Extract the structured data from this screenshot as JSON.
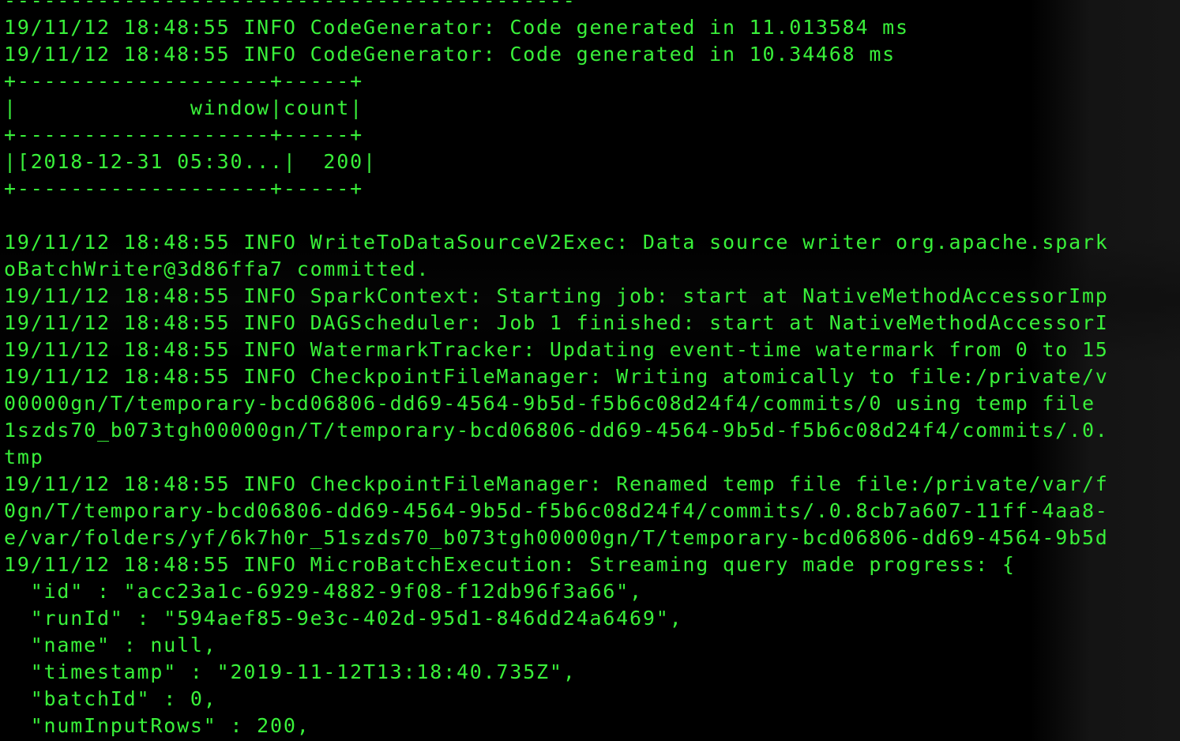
{
  "colors": {
    "background": "#000000",
    "text": "#39f03a"
  },
  "terminal": {
    "lines": [
      "-------------------------------------------",
      "19/11/12 18:48:55 INFO CodeGenerator: Code generated in 11.013584 ms",
      "19/11/12 18:48:55 INFO CodeGenerator: Code generated in 10.34468 ms",
      "+-------------------+-----+",
      "|             window|count|",
      "+-------------------+-----+",
      "|[2018-12-31 05:30...|  200|",
      "+-------------------+-----+",
      "",
      "19/11/12 18:48:55 INFO WriteToDataSourceV2Exec: Data source writer org.apache.spark",
      "oBatchWriter@3d86ffa7 committed.",
      "19/11/12 18:48:55 INFO SparkContext: Starting job: start at NativeMethodAccessorImp",
      "19/11/12 18:48:55 INFO DAGScheduler: Job 1 finished: start at NativeMethodAccessorI",
      "19/11/12 18:48:55 INFO WatermarkTracker: Updating event-time watermark from 0 to 15",
      "19/11/12 18:48:55 INFO CheckpointFileManager: Writing atomically to file:/private/v",
      "00000gn/T/temporary-bcd06806-dd69-4564-9b5d-f5b6c08d24f4/commits/0 using temp file",
      "1szds70_b073tgh00000gn/T/temporary-bcd06806-dd69-4564-9b5d-f5b6c08d24f4/commits/.0.",
      "tmp",
      "19/11/12 18:48:55 INFO CheckpointFileManager: Renamed temp file file:/private/var/f",
      "0gn/T/temporary-bcd06806-dd69-4564-9b5d-f5b6c08d24f4/commits/.0.8cb7a607-11ff-4aa8-",
      "e/var/folders/yf/6k7h0r_51szds70_b073tgh00000gn/T/temporary-bcd06806-dd69-4564-9b5d",
      "19/11/12 18:48:55 INFO MicroBatchExecution: Streaming query made progress: {",
      "  \"id\" : \"acc23a1c-6929-4882-9f08-f12db96f3a66\",",
      "  \"runId\" : \"594aef85-9e3c-402d-95d1-846dd24a6469\",",
      "  \"name\" : null,",
      "  \"timestamp\" : \"2019-11-12T13:18:40.735Z\",",
      "  \"batchId\" : 0,",
      "  \"numInputRows\" : 200,"
    ]
  }
}
